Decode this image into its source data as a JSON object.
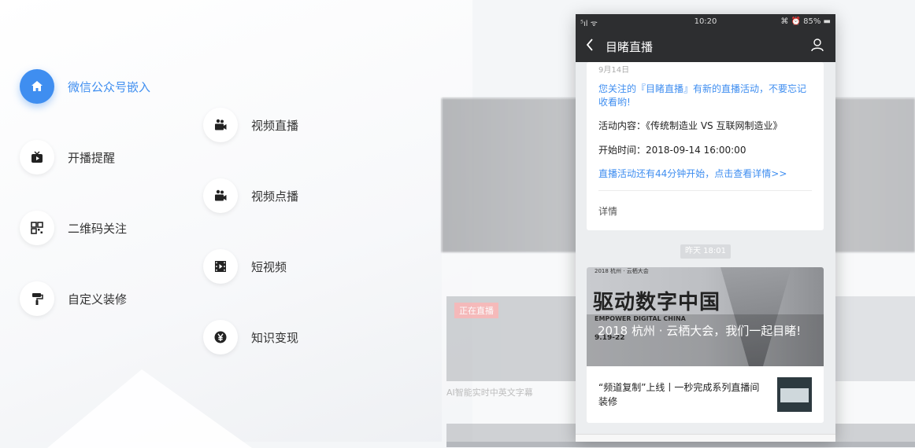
{
  "features": {
    "left": [
      {
        "label": "微信公众号嵌入",
        "icon": "home-icon",
        "glyph": "⌂",
        "active": true
      },
      {
        "label": "开播提醒",
        "icon": "tv-icon",
        "glyph": "▣",
        "active": false
      },
      {
        "label": "二维码关注",
        "icon": "qrcode-icon",
        "glyph": "▦",
        "active": false
      },
      {
        "label": "自定义装修",
        "icon": "paint-roller-icon",
        "glyph": "⊤",
        "active": false
      }
    ],
    "right": [
      {
        "label": "视频直播",
        "icon": "video-camera-icon",
        "glyph": "◙"
      },
      {
        "label": "视频点播",
        "icon": "video-camera-icon",
        "glyph": "◙"
      },
      {
        "label": "短视频",
        "icon": "film-icon",
        "glyph": "▣"
      },
      {
        "label": "知识变现",
        "icon": "yen-icon",
        "glyph": "¥"
      }
    ]
  },
  "background_page": {
    "live_badge": "正在直播",
    "card_title": "AI智能实时中英文字幕"
  },
  "phone": {
    "status": {
      "signal": "⁵ıl ᯤ",
      "time": "10:20",
      "right": "⌘ ⏰ 85% ▬"
    },
    "nav_title": "目睹直播",
    "message": {
      "date": "9月14日",
      "notice": "您关注的『目睹直播』有新的直播活动，不要忘记收看哟!",
      "activity": "活动内容：《传统制造业 VS 互联网制造业》",
      "start_time": "开始时间：2018-09-14 16:00:00",
      "remind": "直播活动还有44分钟开始，点击查看详情>>",
      "detail": "详情"
    },
    "timestamp": "昨天 18:01",
    "article": {
      "cover_small": "2018 杭州 · 云栖大会",
      "cover_big": "驱动数字中国",
      "cover_eng": "EMPOWER DIGITAL CHINA",
      "cover_date": "9.19-22",
      "cover_caption": "2018 杭州 · 云栖大会，我们一起目睹!",
      "title": "“频道复制”上线丨一秒完成系列直播间装修"
    }
  },
  "colors": {
    "accent": "#3f8ef0",
    "phone_bar": "#2d2e30"
  }
}
